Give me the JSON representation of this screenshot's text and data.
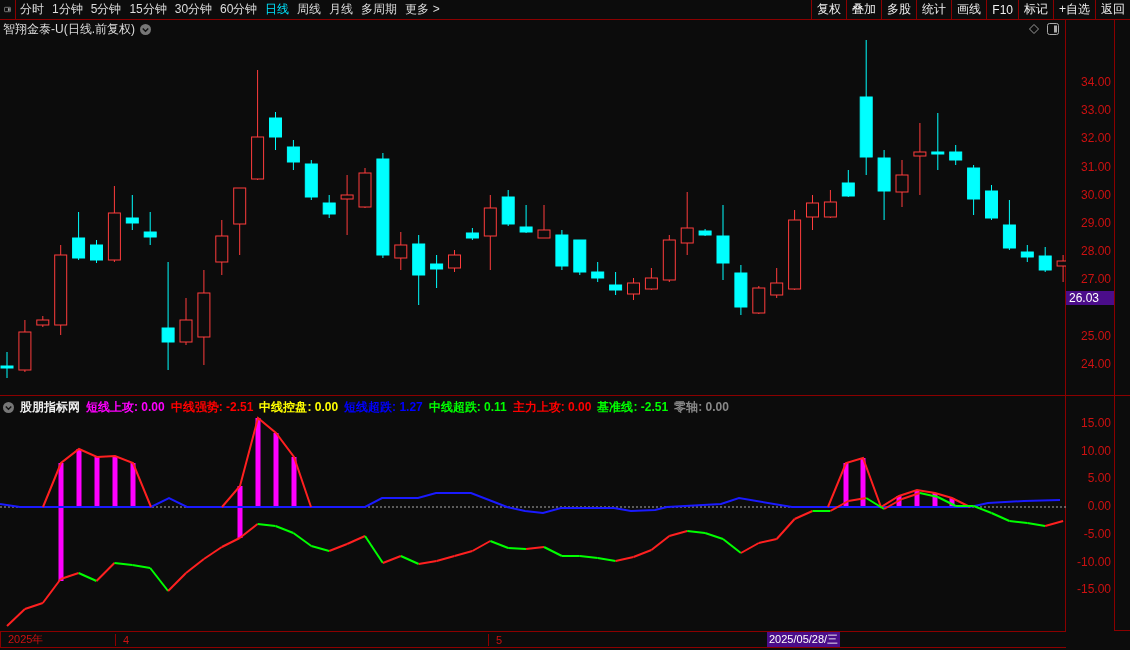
{
  "toolbar": {
    "tabs": [
      {
        "label": "分时",
        "selected": false
      },
      {
        "label": "1分钟",
        "selected": false
      },
      {
        "label": "5分钟",
        "selected": false
      },
      {
        "label": "15分钟",
        "selected": false
      },
      {
        "label": "30分钟",
        "selected": false
      },
      {
        "label": "60分钟",
        "selected": false
      },
      {
        "label": "日线",
        "selected": true
      },
      {
        "label": "周线",
        "selected": false
      },
      {
        "label": "月线",
        "selected": false
      },
      {
        "label": "多周期",
        "selected": false
      },
      {
        "label": "更多 >",
        "selected": false
      }
    ],
    "buttons": [
      "复权",
      "叠加",
      "多股",
      "统计",
      "画线",
      "F10",
      "标记",
      "+自选",
      "返回"
    ]
  },
  "chart": {
    "title": "智翔金泰-U(日线.前复权)",
    "price_ticks": [
      "34.00",
      "33.00",
      "32.00",
      "31.00",
      "30.00",
      "29.00",
      "28.00",
      "27.00",
      "25.00",
      "24.00"
    ],
    "last_price": "26.03"
  },
  "indicator": {
    "name": "股朋指标网",
    "legend": [
      {
        "label": "短线上攻:",
        "value": "0.00",
        "color": "#ff00ff"
      },
      {
        "label": "中线强势:",
        "value": "-2.51",
        "color": "#ff0000"
      },
      {
        "label": "中线控盘:",
        "value": "0.00",
        "color": "#ffff00"
      },
      {
        "label": "短线超跌:",
        "value": "1.27",
        "color": "#0000ff"
      },
      {
        "label": "中线超跌:",
        "value": "0.11",
        "color": "#00ff00"
      },
      {
        "label": "主力上攻:",
        "value": "0.00",
        "color": "#ff0000"
      },
      {
        "label": "基准线:",
        "value": "-2.51",
        "color": "#00ff00"
      },
      {
        "label": "零轴:",
        "value": "0.00",
        "color": "#888888"
      }
    ],
    "ticks": [
      "15.00",
      "10.00",
      "5.00",
      "0.00",
      "-5.00",
      "-10.00",
      "-15.00"
    ]
  },
  "date_axis": {
    "labels": [
      "2025年",
      "4",
      "5"
    ],
    "cursor_date": "2025/05/28/三"
  }
}
